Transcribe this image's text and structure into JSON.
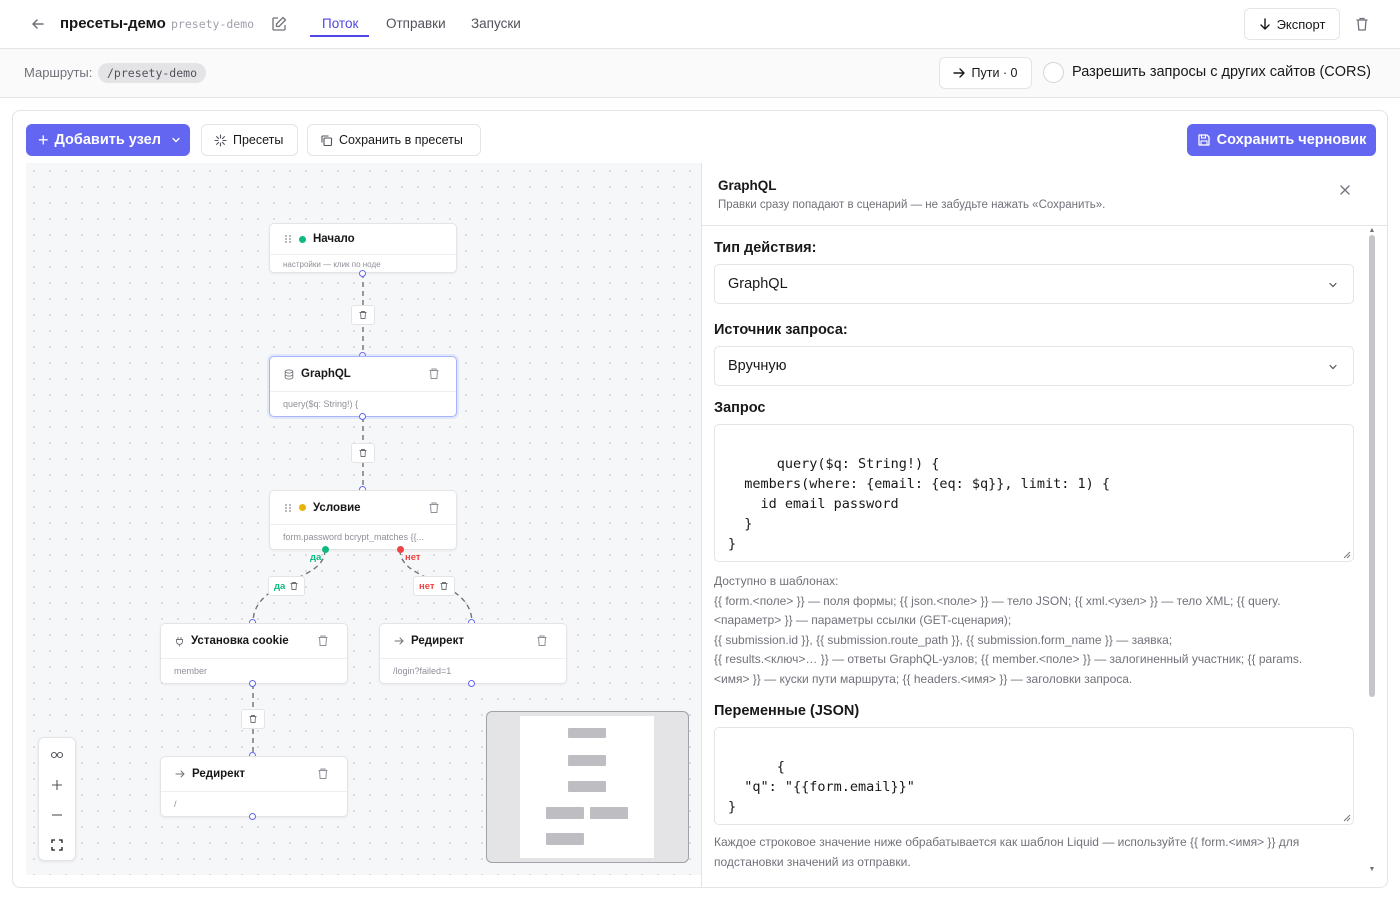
{
  "header": {
    "project_title": "пресеты-демо",
    "project_slug": "presety-demo",
    "tabs": [
      {
        "label": "Поток",
        "active": true
      },
      {
        "label": "Отправки",
        "active": false
      },
      {
        "label": "Запуски",
        "active": false
      }
    ],
    "export_label": "Экспорт"
  },
  "routes": {
    "label": "Маршруты:",
    "chip": "/presety-demo",
    "paths_button": "Пути · 0",
    "cors_label": "Разрешить запросы с других сайтов (CORS)",
    "cors_checked": false
  },
  "toolbar": {
    "add_node": "Добавить узел",
    "presets": "Пресеты",
    "save_to_presets": "Сохранить в пресеты",
    "save_draft": "Сохранить черновик"
  },
  "flow": {
    "nodes": [
      {
        "id": "start",
        "title": "Начало",
        "body": "настройки — клик по ноде",
        "icon": "drag-handle-icon",
        "status_color": "#10b981"
      },
      {
        "id": "graphql",
        "title": "GraphQL",
        "body": "query($q: String!) {",
        "icon": "database-icon",
        "selected": true
      },
      {
        "id": "condition",
        "title": "Условие",
        "body": "form.password bcrypt_matches {{...",
        "icon": "drag-handle-icon",
        "status_color": "#eab308"
      },
      {
        "id": "set-cookie",
        "title": "Установка cookie",
        "body": "member",
        "icon": "plug-icon"
      },
      {
        "id": "redirect-fail",
        "title": "Редирект",
        "body": "/login?failed=1",
        "icon": "arrow-right-icon"
      },
      {
        "id": "redirect",
        "title": "Редирект",
        "body": "/",
        "icon": "arrow-right-icon"
      }
    ],
    "branch_yes": "да",
    "branch_no": "нет",
    "colors": {
      "yes": "#10b981",
      "no": "#ef4444",
      "accent": "#6366f1"
    }
  },
  "panel": {
    "title": "GraphQL",
    "subtitle": "Правки сразу попадают в сценарий — не забудьте нажать «Сохранить».",
    "action_type_label": "Тип действия:",
    "action_type_value": "GraphQL",
    "source_label": "Источник запроса:",
    "source_value": "Вручную",
    "query_label": "Запрос",
    "query_value": "query($q: String!) {\n  members(where: {email: {eq: $q}}, limit: 1) {\n    id email password\n  }\n}",
    "help_lines": [
      "Доступно в шаблонах:",
      "{{ form.<поле> }} — поля формы; {{ json.<поле> }} — тело JSON; {{ xml.<узел> }} — тело XML; {{ query.",
      "<параметр> }} — параметры ссылки (GET-сценария);",
      "{{ submission.id }}, {{ submission.route_path }}, {{ submission.form_name }} — заявка;",
      "{{ results.<ключ>… }} — ответы GraphQL-узлов; {{ member.<поле> }} — залогиненный участник; {{ params.",
      "<имя> }} — куски пути маршрута; {{ headers.<имя> }} — заголовки запроса."
    ],
    "variables_label": "Переменные (JSON)",
    "variables_value": "{\n  \"q\": \"{{form.email}}\"\n}",
    "variables_help": "Каждое строковое значение ниже обрабатывается как шаблон Liquid — используйте {{ form.<имя> }} для подстановки значений из отправки."
  }
}
